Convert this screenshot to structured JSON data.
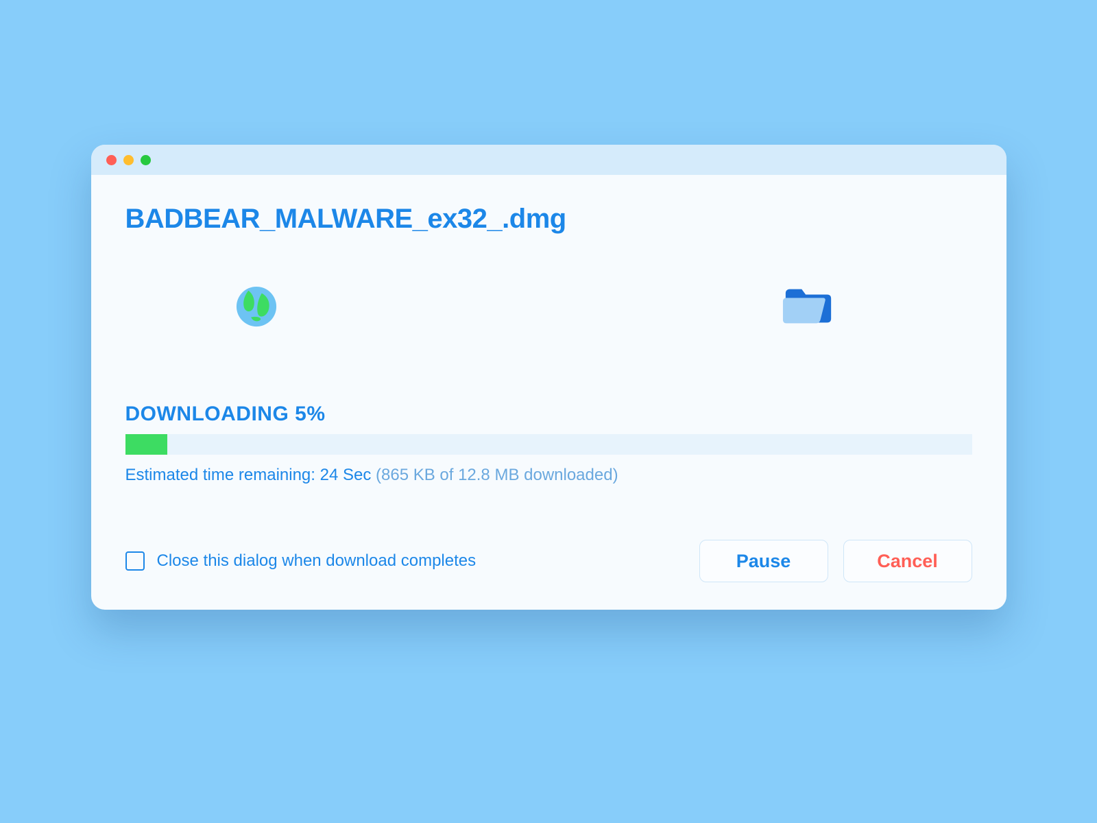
{
  "dialog": {
    "filename": "BADBEAR_MALWARE_ex32_.dmg",
    "progress": {
      "label": "DOWNLOADING 5%",
      "percent": 5,
      "eta_label": "Estimated time remaining: 24 Sec ",
      "eta_detail": "(865 KB of 12.8 MB downloaded)"
    },
    "close_on_complete_label": "Close this dialog when download completes",
    "buttons": {
      "pause": "Pause",
      "cancel": "Cancel"
    },
    "icon_names": {
      "source": "globe-icon",
      "destination": "folder-icon"
    },
    "colors": {
      "primary": "#1C87E8",
      "progress_fill": "#3DDC62",
      "cancel": "#FF5F56"
    }
  }
}
